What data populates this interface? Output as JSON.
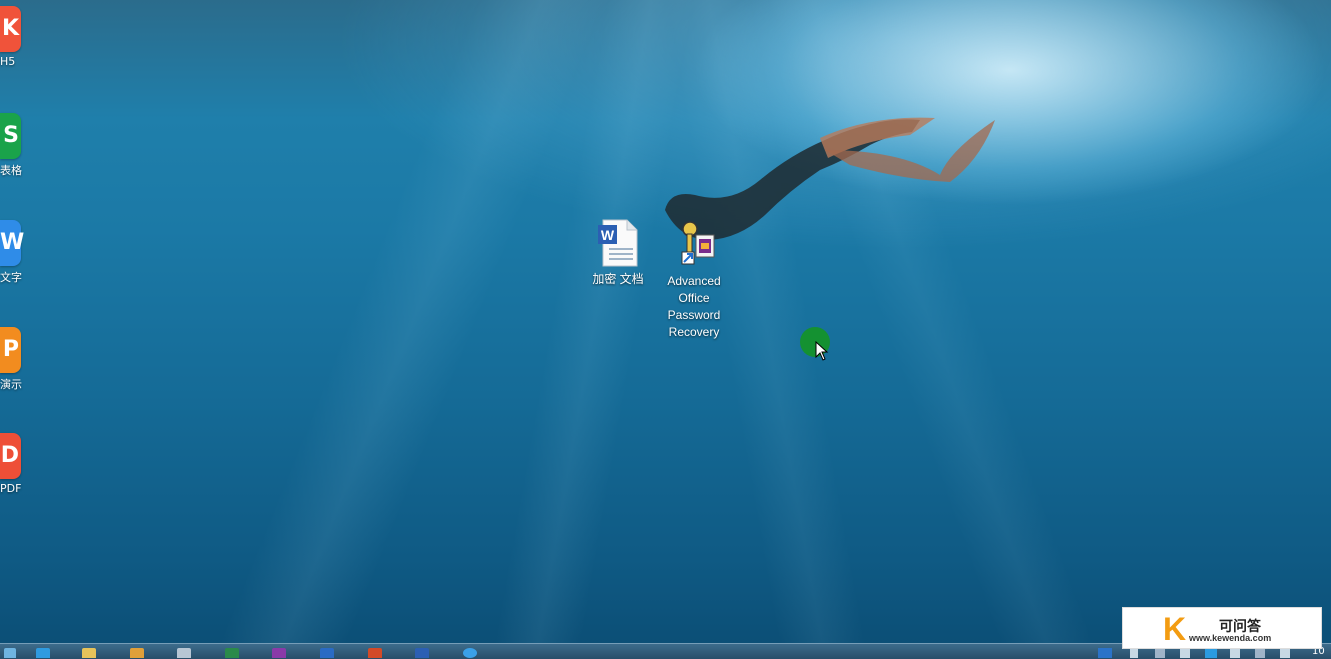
{
  "desktop": {
    "left_icons": [
      {
        "glyph": "K",
        "label": "H5",
        "color": "#f0533a"
      },
      {
        "glyph": "S",
        "label": "表格",
        "color": "#1aa34a"
      },
      {
        "glyph": "W",
        "label": "文字",
        "color": "#2f8ce8"
      },
      {
        "glyph": "P",
        "label": "演示",
        "color": "#f28c1f"
      },
      {
        "glyph": "D",
        "label": "PDF",
        "color": "#ee4f37"
      }
    ],
    "icons": [
      {
        "label": "加密 文档",
        "icon": "word-document-icon"
      },
      {
        "label": "Advanced Office Password Recovery",
        "icon": "password-recovery-keys-icon"
      }
    ]
  },
  "watermark": {
    "logo": "K",
    "title": "可问答",
    "url": "www.kewenda.com"
  },
  "taskbar": {
    "clock_partial": "10"
  },
  "colors": {
    "taskbar": "#2f5a78",
    "water_top": "#1f7fab",
    "water_bottom": "#0b4d74",
    "cursor_highlight": "#16961e"
  }
}
